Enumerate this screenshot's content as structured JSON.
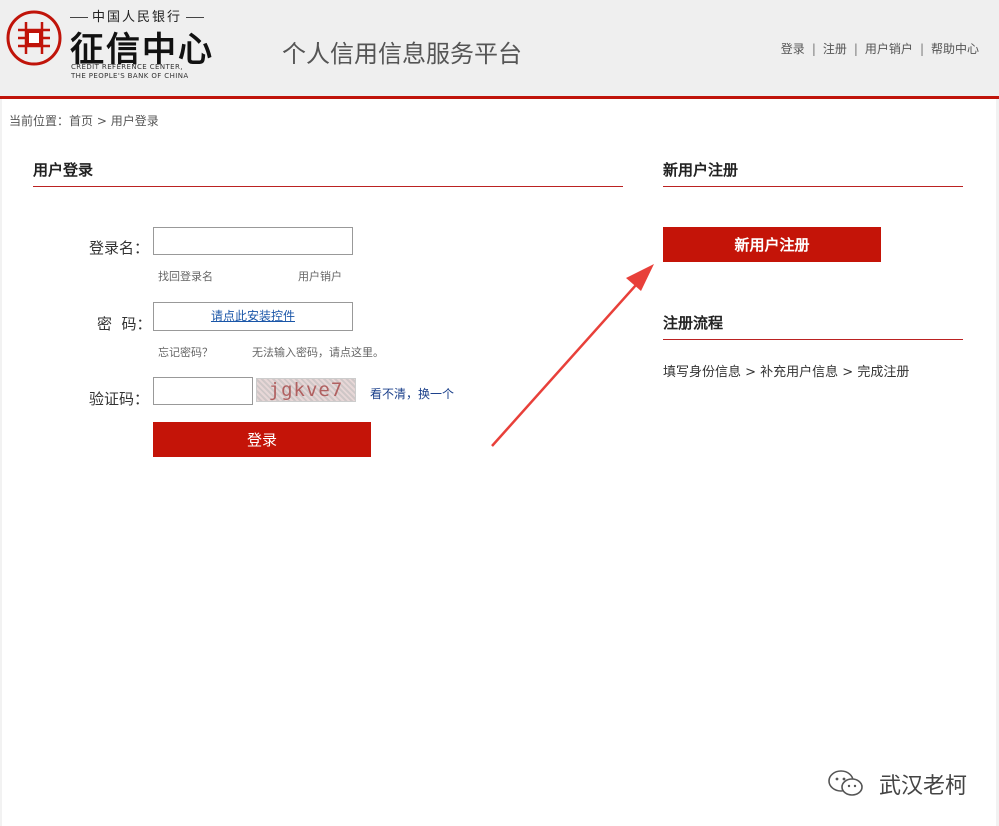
{
  "header": {
    "logo": {
      "top_text": "中国人民银行",
      "name_cn": "征信中心",
      "name_en_line1": "CREDIT REFERENCE CENTER,",
      "name_en_line2": "THE PEOPLE'S BANK OF CHINA"
    },
    "site_title": "个人信用信息服务平台",
    "nav": [
      {
        "label": "登录"
      },
      {
        "label": "注册"
      },
      {
        "label": "用户销户"
      },
      {
        "label": "帮助中心"
      }
    ],
    "nav_separator": "|"
  },
  "breadcrumb": {
    "prefix": "当前位置：",
    "home": "首页",
    "separator": " > ",
    "current": "用户登录"
  },
  "login": {
    "title": "用户登录",
    "username_label": "登录名：",
    "username_value": "",
    "recover_username": "找回登录名",
    "cancel_account": "用户销户",
    "password_label": "密  码：",
    "install_plugin": "请点此安装控件",
    "forgot_password": "忘记密码？",
    "cannot_input": "无法输入密码，请点这里。",
    "captcha_label": "验证码：",
    "captcha_value": "",
    "captcha_image_text": "jgkve7",
    "unclear": "看不清",
    "comma": "，",
    "change_one": "换一个",
    "submit": "登录"
  },
  "register": {
    "title": "新用户注册",
    "button": "新用户注册",
    "flow_title": "注册流程",
    "flow_text": "填写身份信息 > 补充用户信息 > 完成注册"
  },
  "watermark": {
    "text": "武汉老柯"
  },
  "colors": {
    "accent": "#c41408",
    "header_bg": "#efefef",
    "annotation_arrow": "#e8403a"
  }
}
